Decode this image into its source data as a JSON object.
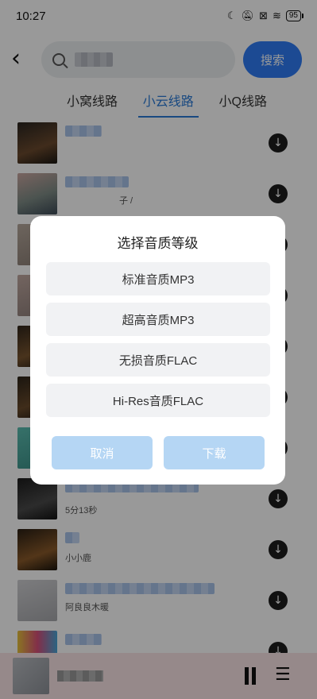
{
  "status_bar": {
    "time": "10:27",
    "icons": [
      "moon-icon",
      "bell-muted-icon",
      "sim-x-icon",
      "wifi-icon"
    ],
    "battery": "95"
  },
  "search": {
    "query": "▒▒▒▒",
    "button_label": "搜索"
  },
  "tabs": [
    {
      "label": "小窝线路",
      "active": false
    },
    {
      "label": "小云线路",
      "active": true
    },
    {
      "label": "小Q线路",
      "active": false
    }
  ],
  "songs": [
    {
      "title": "▒▒▒▒▒",
      "subtitle": ""
    },
    {
      "title": "▒▒▒▒▒▒▒▒▒",
      "subtitle": "子 /"
    },
    {
      "title": "▒▒▒▒▒",
      "subtitle": ""
    },
    {
      "title": "▒▒▒▒▒",
      "subtitle": ""
    },
    {
      "title": "▒▒▒▒▒",
      "subtitle": ""
    },
    {
      "title": "▒▒▒▒▒",
      "subtitle": ""
    },
    {
      "title": "▒▒▒▒▒",
      "subtitle": ""
    },
    {
      "title": "▒▒▒▒▒▒▒▒▒▒▒▒▒▒▒ (▒▒▒▒)",
      "subtitle": "5分13秒"
    },
    {
      "title": "▒▒▒",
      "subtitle": "小小鹿"
    },
    {
      "title": "▒▒▒▒▒▒▒▒▒▒▒▒▒▒▒▒▒▒",
      "subtitle": "阿良良木暖"
    },
    {
      "title": "▒▒▒▒▒",
      "subtitle": ""
    }
  ],
  "player": {
    "title": "▒▒▒▒▒"
  },
  "dialog": {
    "title": "选择音质等级",
    "options": [
      "标准音质MP3",
      "超高音质MP3",
      "无损音质FLAC",
      "Hi-Res音质FLAC"
    ],
    "cancel_label": "取消",
    "download_label": "下载"
  },
  "colors": {
    "accent": "#2f7cf6",
    "tab_active": "#2a7bd8",
    "dialog_button": "#b5d6f4",
    "player_bar": "#fbe4e6"
  }
}
